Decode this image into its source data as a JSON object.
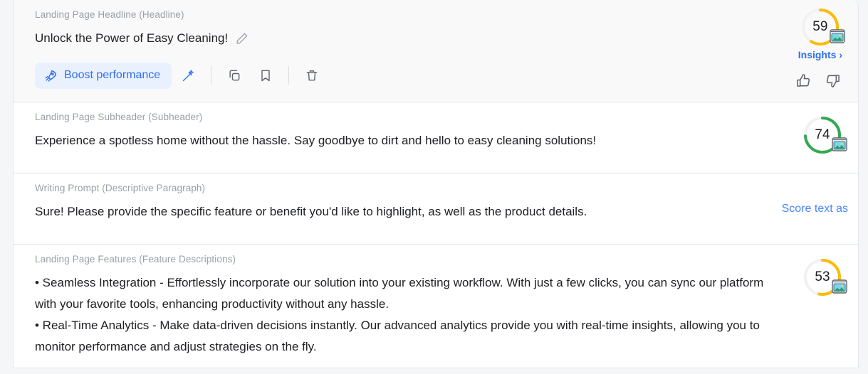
{
  "cards": [
    {
      "label": "Landing Page Headline (Headline)",
      "text": "Unlock the Power of Easy Cleaning!",
      "score": "59",
      "score_color": "#fbbc04",
      "score_pct": 59,
      "insights_label": "Insights ›",
      "edit_icon": "pencil-icon",
      "toolbar": {
        "boost_label": "Boost performance",
        "boost_icon": "rocket-icon",
        "wand_icon": "magic-wand-icon",
        "copy_icon": "copy-icon",
        "bookmark_icon": "bookmark-icon",
        "delete_icon": "trash-icon"
      },
      "feedback": {
        "like_icon": "thumbs-up-icon",
        "dislike_icon": "thumbs-down-icon"
      }
    },
    {
      "label": "Landing Page Subheader (Subheader)",
      "text": "Experience a spotless home without the hassle. Say goodbye to dirt and hello to easy cleaning solutions!",
      "score": "74",
      "score_color": "#34a853",
      "score_pct": 74
    },
    {
      "label": "Writing Prompt (Descriptive Paragraph)",
      "text": "Sure! Please provide the specific feature or benefit you'd like to highlight, as well as the product details.",
      "score_text_link": "Score text as"
    },
    {
      "label": "Landing Page Features (Feature Descriptions)",
      "text": "• Seamless Integration - Effortlessly incorporate our solution into your existing workflow. With just a few clicks, you can sync our platform with your favorite tools, enhancing productivity without any hassle.\n• Real-Time Analytics - Make data-driven decisions instantly. Our advanced analytics provide you with real-time insights, allowing you to monitor performance and adjust strategies on the fly.",
      "score": "53",
      "score_color": "#fbbc04",
      "score_pct": 53
    }
  ],
  "colors": {
    "accent_blue": "#2f6fed",
    "link_blue": "#4a86f7",
    "yellow": "#fbbc04",
    "green": "#34a853",
    "border": "#e3e5e8"
  }
}
